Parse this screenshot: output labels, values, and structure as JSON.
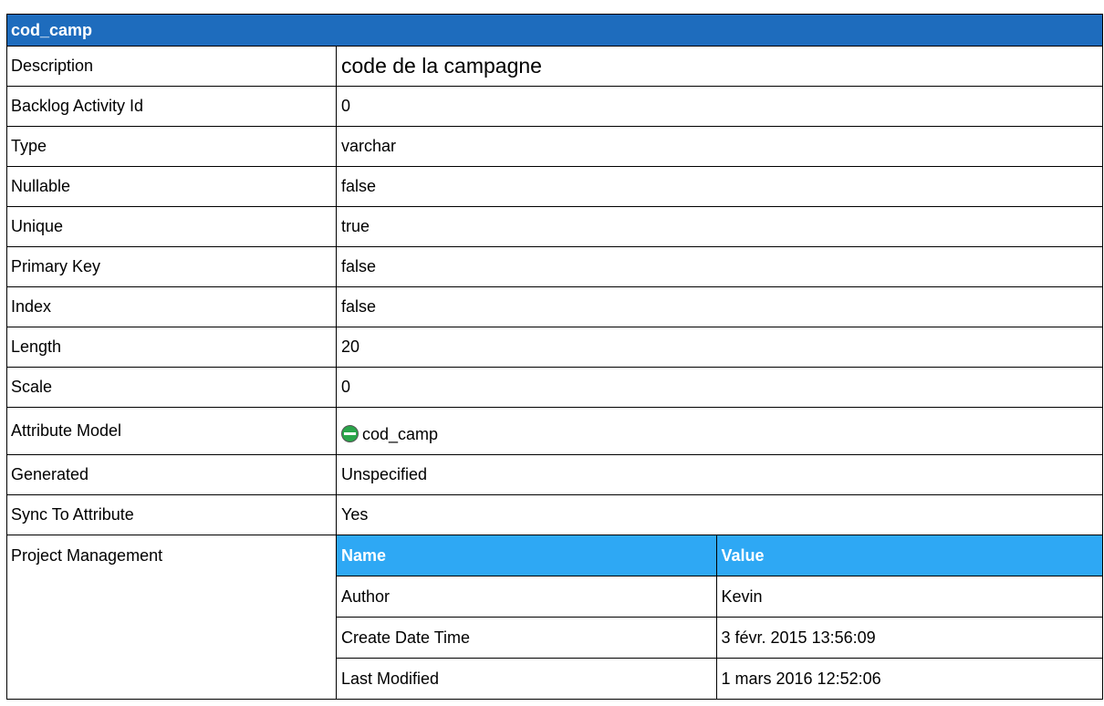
{
  "title": "cod_camp",
  "rows": {
    "description": {
      "label": "Description",
      "value": "code de la campagne"
    },
    "backlog": {
      "label": "Backlog Activity Id",
      "value": "0"
    },
    "type": {
      "label": "Type",
      "value": "varchar"
    },
    "nullable": {
      "label": "Nullable",
      "value": "false"
    },
    "unique": {
      "label": "Unique",
      "value": "true"
    },
    "primary_key": {
      "label": "Primary Key",
      "value": "false"
    },
    "index": {
      "label": "Index",
      "value": "false"
    },
    "length": {
      "label": "Length",
      "value": "20"
    },
    "scale": {
      "label": "Scale",
      "value": "0"
    },
    "attribute_model": {
      "label": "Attribute Model",
      "value": "cod_camp",
      "icon": "attribute-icon"
    },
    "generated": {
      "label": "Generated",
      "value": "Unspecified"
    },
    "sync": {
      "label": "Sync To Attribute",
      "value": "Yes"
    }
  },
  "project_management": {
    "label": "Project Management",
    "headers": {
      "name": "Name",
      "value": "Value"
    },
    "items": [
      {
        "name": "Author",
        "value": "Kevin"
      },
      {
        "name": "Create Date Time",
        "value": "3 févr. 2015 13:56:09"
      },
      {
        "name": "Last Modified",
        "value": "1 mars 2016 12:52:06"
      }
    ]
  },
  "colors": {
    "title_bg": "#1e6cbd",
    "subheader_bg": "#2ea8f4",
    "icon_green": "#2aa54a"
  }
}
